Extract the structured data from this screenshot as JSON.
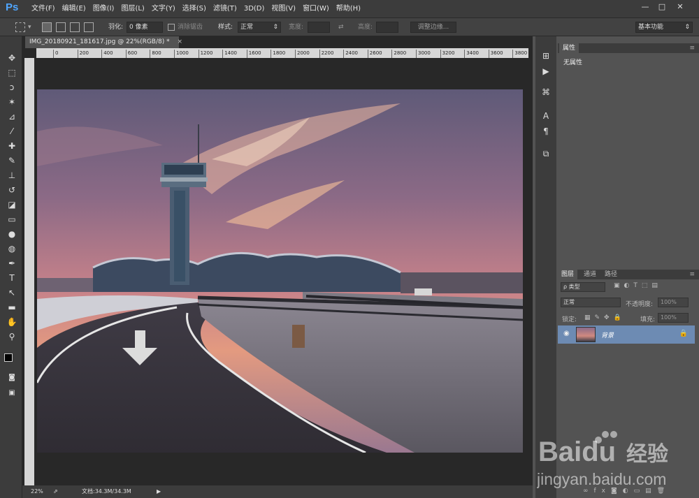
{
  "app": {
    "logo": "Ps",
    "window_buttons": [
      "—",
      "□",
      "✕"
    ]
  },
  "menu": [
    "文件(F)",
    "编辑(E)",
    "图像(I)",
    "图层(L)",
    "文字(Y)",
    "选择(S)",
    "滤镜(T)",
    "3D(D)",
    "视图(V)",
    "窗口(W)",
    "帮助(H)"
  ],
  "options": {
    "feather_label": "羽化:",
    "feather_value": "0 像素",
    "antialias_label": "消除锯齿",
    "style_label": "样式:",
    "style_value": "正常",
    "width_label": "宽度:",
    "height_label": "高度:",
    "refine_edge": "调整边缘...",
    "workspace": "基本功能"
  },
  "document": {
    "tab_title": "IMG_20180921_181617.jpg @ 22%(RGB/8) *",
    "ruler_ticks": [
      "0",
      "200",
      "400",
      "600",
      "800",
      "1000",
      "1200",
      "1400",
      "1600",
      "1800",
      "2000",
      "2200",
      "2400",
      "2600",
      "2800",
      "3000",
      "3200",
      "3400",
      "3600",
      "3800"
    ],
    "zoom": "22%",
    "doc_info": "文档:34.3M/34.3M"
  },
  "properties": {
    "tab": "属性",
    "empty_text": "无属性"
  },
  "layers": {
    "tabs": [
      "图层",
      "通道",
      "路径"
    ],
    "filter_kind": "ρ 类型",
    "blend_mode": "正常",
    "opacity_label": "不透明度:",
    "opacity_value": "100%",
    "lock_label": "锁定:",
    "fill_label": "填充:",
    "fill_value": "100%",
    "items": [
      {
        "name": "背景"
      }
    ]
  },
  "watermark": {
    "brand": "Baidu",
    "brand_cn": "经验",
    "url": "jingyan.baidu.com"
  }
}
